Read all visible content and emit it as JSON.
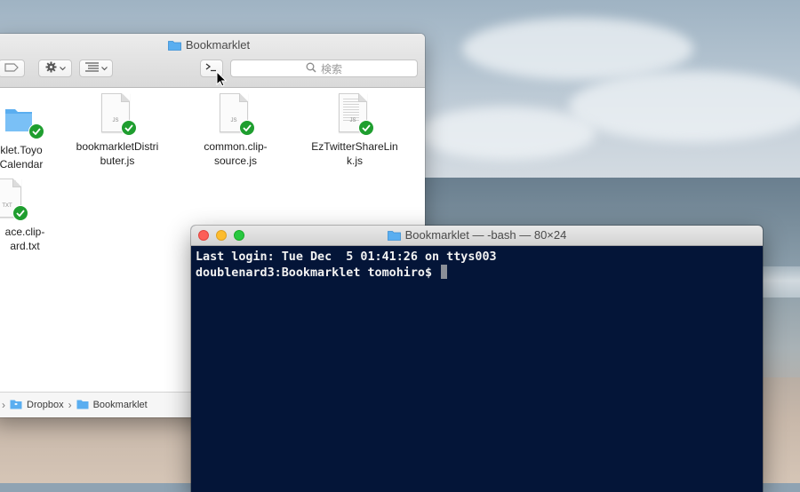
{
  "finder": {
    "title": "Bookmarklet",
    "search_placeholder": "検索",
    "files": [
      {
        "name": "klet.Toyo Calendar",
        "line1": "klet.Toyo",
        "line2": "Calendar",
        "kind": "folder"
      },
      {
        "name": "bookmarkletDistributer.js",
        "line1": "bookmarkletDistri",
        "line2": "buter.js",
        "kind": "js",
        "tag": "JS"
      },
      {
        "name": "common.clip-source.js",
        "line1": "common.clip-",
        "line2": "source.js",
        "kind": "js",
        "tag": "JS"
      },
      {
        "name": "EzTwitterShareLink.js",
        "line1": "EzTwitterShareLin",
        "line2": "k.js",
        "kind": "js-lines",
        "tag": "JS"
      },
      {
        "name": "ace.clip-ard.txt",
        "line1": "ace.clip-",
        "line2": "ard.txt",
        "kind": "txt",
        "tag": "TXT"
      }
    ],
    "pathbar": [
      "Dropbox",
      "Bookmarklet"
    ]
  },
  "terminal": {
    "title": "Bookmarklet — -bash — 80×24",
    "lines": [
      "Last login: Tue Dec  5 01:41:26 on ttys003",
      "doublenard3:Bookmarklet tomohiro$ "
    ]
  },
  "colors": {
    "terminal_bg": "#041538",
    "terminal_fg": "#f2f2f2",
    "check_green": "#1f9e2f",
    "folder_blue": "#5aaef0"
  },
  "icons": [
    "folder-icon",
    "gear-icon",
    "list-view-icon",
    "terminal-icon",
    "search-icon",
    "sync-check-icon",
    "dropbox-icon",
    "mouse-pointer-icon"
  ]
}
